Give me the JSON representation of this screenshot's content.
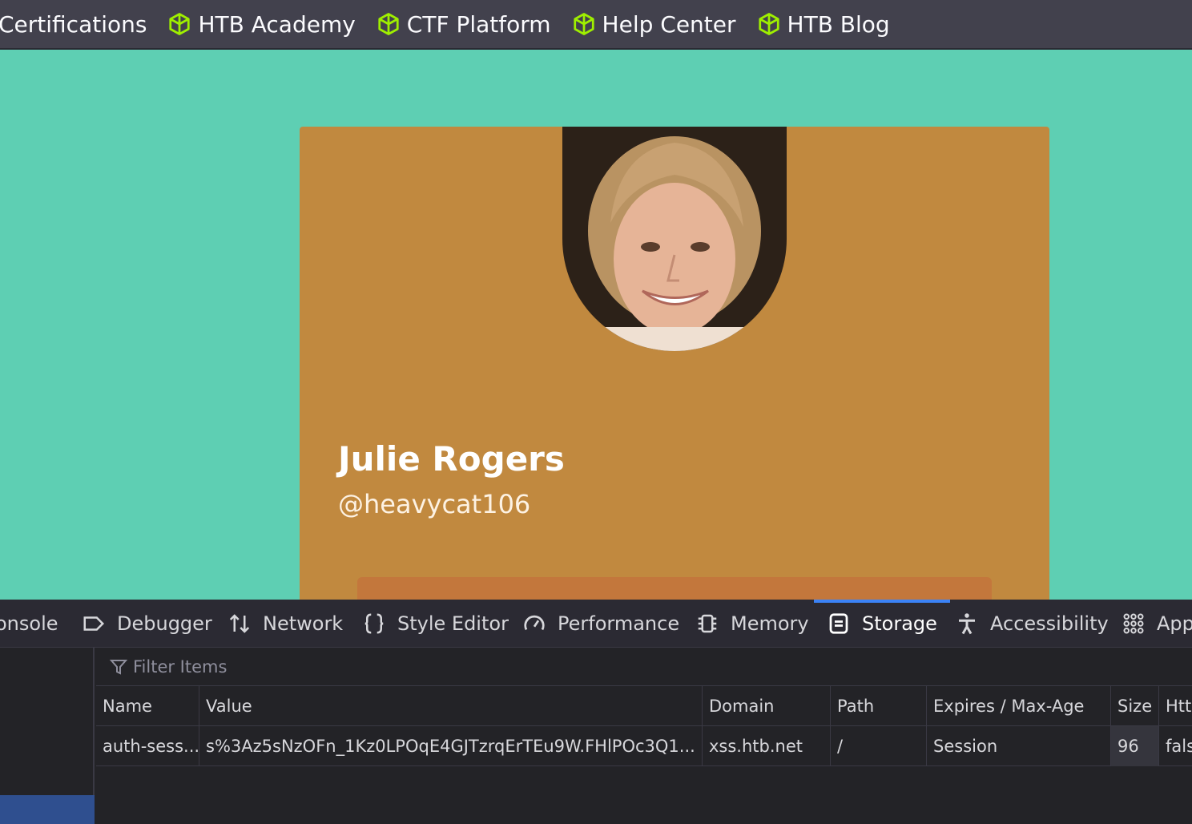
{
  "bookmarks": [
    {
      "label": "Certifications",
      "has_icon": false
    },
    {
      "label": "HTB Academy",
      "has_icon": true
    },
    {
      "label": "CTF Platform",
      "has_icon": true
    },
    {
      "label": "Help Center",
      "has_icon": true
    },
    {
      "label": "HTB Blog",
      "has_icon": true
    }
  ],
  "profile": {
    "name": "Julie Rogers",
    "handle": "@heavycat106",
    "card_color": "#c1893f",
    "page_bg": "#5ecfb3"
  },
  "devtools": {
    "tabs": [
      {
        "label": "onsole",
        "icon": "console-icon"
      },
      {
        "label": "Debugger",
        "icon": "debugger-icon"
      },
      {
        "label": "Network",
        "icon": "network-arrows-icon"
      },
      {
        "label": "Style Editor",
        "icon": "braces-icon"
      },
      {
        "label": "Performance",
        "icon": "gauge-icon"
      },
      {
        "label": "Memory",
        "icon": "chip-icon"
      },
      {
        "label": "Storage",
        "icon": "storage-icon",
        "active": true
      },
      {
        "label": "Accessibility",
        "icon": "accessibility-icon"
      },
      {
        "label": "App",
        "icon": "grid-icon"
      }
    ],
    "filter_placeholder": "Filter Items",
    "columns": [
      "Name",
      "Value",
      "Domain",
      "Path",
      "Expires / Max-Age",
      "Size",
      "Htt"
    ],
    "rows": [
      [
        "auth-sess...",
        "s%3Az5sNzOFn_1Kz0LPOqE4GJTzrqErTEu9W.FHlPOc3Q1...",
        "xss.htb.net",
        "/",
        "Session",
        "96",
        "fals"
      ]
    ]
  }
}
